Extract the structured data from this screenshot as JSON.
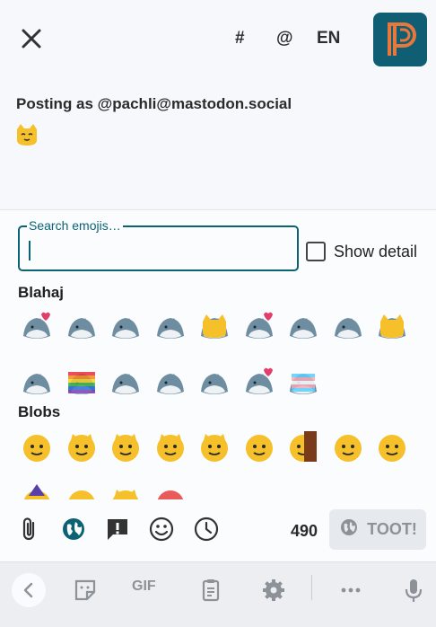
{
  "header": {
    "close_icon": "close-icon",
    "hashtag_label": "#",
    "mention_label": "@",
    "language_label": "EN",
    "logo_letter": "P"
  },
  "compose": {
    "posting_as": "Posting as @pachli@mastodon.social",
    "avatar_icon": "cat-face-icon"
  },
  "emoji_picker": {
    "search_placeholder": "Search emojis…",
    "search_value": "",
    "show_detail_label": "Show detail",
    "show_detail_checked": false,
    "categories": [
      {
        "name": "Blahaj",
        "emoji_icons": [
          "blahaj-heart-icon",
          "blahaj-face-icon",
          "blahaj-hooded-icon",
          "blahaj-hooded-2-icon",
          "blahaj-cat-icon",
          "blahaj-heart-icon",
          "blahaj-leaf-icon",
          "blahaj-sock-icon",
          "blahaj-cat-2-icon",
          "blahaj-icon",
          "blahaj-pride-icon",
          "blahaj-swim-icon",
          "blahaj-swim-2-icon",
          "blahaj-swim-3-icon",
          "blahaj-love-icon",
          "blahaj-trans-icon"
        ]
      },
      {
        "name": "Blobs",
        "emoji_icons": [
          "blob-face-icon",
          "blob-cat-icon",
          "blob-cat-happy-icon",
          "blob-cat-sleep-icon",
          "blob-cat-wave-icon",
          "blob-smirk-icon",
          "blob-wall-icon",
          "blob-nervous-icon",
          "blob-open-mouth-icon",
          "blob-wizard-icon",
          "blob-sweat-icon",
          "blob-cat-grumpy-icon",
          "blob-red-icon"
        ]
      }
    ]
  },
  "toolbar": {
    "icons": [
      "paperclip-icon",
      "globe-icon",
      "warning-icon",
      "smiley-icon",
      "clock-icon"
    ],
    "char_count": "490",
    "toot_label": "TOOT!"
  },
  "keyboard": {
    "gif_label": "GIF",
    "icons": [
      "chevron-left-icon",
      "sticker-icon",
      "clipboard-icon",
      "settings-icon",
      "more-icon",
      "mic-icon"
    ]
  },
  "colors": {
    "accent": "#0b6273",
    "logo_bg": "#0f5e73",
    "logo_fg": "#e8773b",
    "emoji_yellow": "#f5c02a",
    "emoji_blue": "#6e8da1"
  }
}
